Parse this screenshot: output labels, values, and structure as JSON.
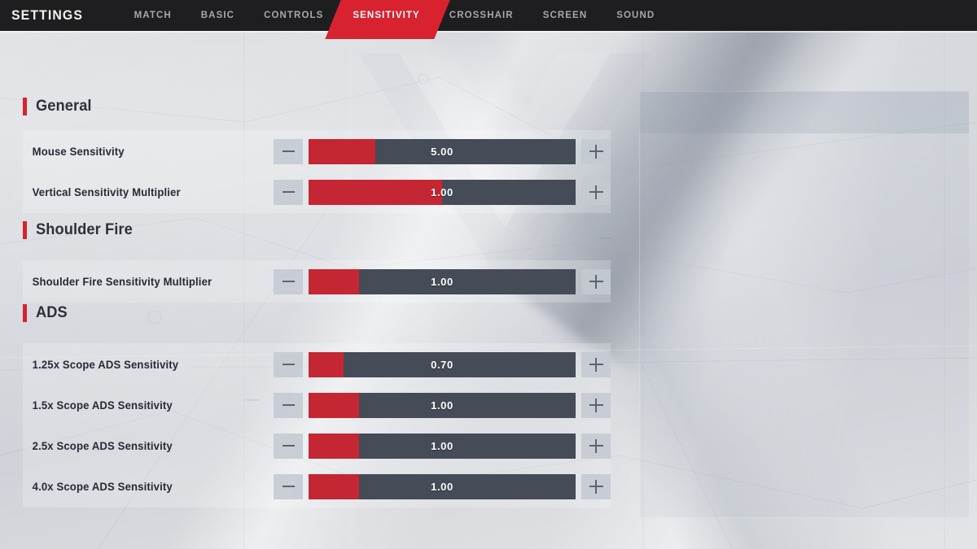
{
  "header": {
    "title": "SETTINGS",
    "tabs": [
      {
        "label": "MATCH",
        "active": false
      },
      {
        "label": "BASIC",
        "active": false
      },
      {
        "label": "CONTROLS",
        "active": false
      },
      {
        "label": "SENSITIVITY",
        "active": true
      },
      {
        "label": "CROSSHAIR",
        "active": false
      },
      {
        "label": "SCREEN",
        "active": false
      },
      {
        "label": "SOUND",
        "active": false
      }
    ]
  },
  "colors": {
    "accent_red": "#d8222f",
    "slider_fill": "#c42634",
    "slider_track": "#454b57",
    "header_bg": "#1e1e20",
    "text_dark": "#262a33"
  },
  "sections": [
    {
      "title": "General",
      "rows": [
        {
          "label": "Mouse Sensitivity",
          "value": "5.00",
          "fill_percent": 25
        },
        {
          "label": "Vertical Sensitivity Multiplier",
          "value": "1.00",
          "fill_percent": 50
        }
      ]
    },
    {
      "title": "Shoulder Fire",
      "rows": [
        {
          "label": "Shoulder Fire Sensitivity Multiplier",
          "value": "1.00",
          "fill_percent": 19
        }
      ]
    },
    {
      "title": "ADS",
      "rows": [
        {
          "label": "1.25x Scope ADS Sensitivity",
          "value": "0.70",
          "fill_percent": 13
        },
        {
          "label": "1.5x Scope ADS Sensitivity",
          "value": "1.00",
          "fill_percent": 19
        },
        {
          "label": "2.5x Scope ADS Sensitivity",
          "value": "1.00",
          "fill_percent": 19
        },
        {
          "label": "4.0x Scope ADS Sensitivity",
          "value": "1.00",
          "fill_percent": 19
        }
      ]
    }
  ],
  "stepper": {
    "decrease_icon": "minus-icon",
    "increase_icon": "plus-icon"
  }
}
